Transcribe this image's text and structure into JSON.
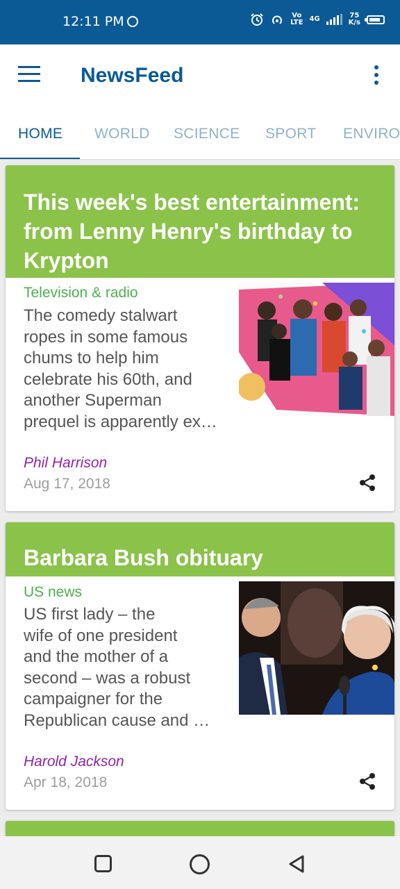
{
  "status": {
    "time": "12:11 PM",
    "lte_top": "Vo",
    "lte_bottom": "LTE",
    "net_badge": "4G",
    "speed_top": "75",
    "speed_bottom": "K/s",
    "icons": [
      "hotspot-icon",
      "alarm-icon",
      "wifi-hotspot-icon",
      "signal-icon",
      "battery-icon"
    ]
  },
  "app_bar": {
    "title": "NewsFeed",
    "menu_icon": "hamburger-menu-icon",
    "more_icon": "more-vert-icon"
  },
  "tabs": [
    {
      "label": "HOME",
      "active": true
    },
    {
      "label": "WORLD",
      "active": false
    },
    {
      "label": "SCIENCE",
      "active": false
    },
    {
      "label": "SPORT",
      "active": false
    },
    {
      "label": "ENVIRO",
      "active": false
    }
  ],
  "colors": {
    "primary": "#0b5a96",
    "header_green": "#8bc34a",
    "section_green": "#4caf50",
    "author_purple": "#8e24aa"
  },
  "articles": [
    {
      "title_lines": [
        "This week's best entertainment:",
        "from Lenny Henry's birthday to",
        "Krypton"
      ],
      "section": "Television & radio",
      "summary_lines": [
        "The comedy stalwart",
        "ropes in some famous",
        "chums to help him",
        "celebrate his 60th, and",
        "another Superman",
        "prequel is apparently ex…"
      ],
      "author": "Phil Harrison",
      "date": "Aug 17, 2018"
    },
    {
      "title_lines": [
        "Barbara Bush obituary"
      ],
      "section": "US news",
      "summary_lines": [
        "US first lady – the",
        "wife of one president",
        "and the mother of a",
        "second – was a robust",
        "campaigner for the",
        "Republican cause and …"
      ],
      "author": "Harold Jackson",
      "date": "Apr 18, 2018"
    }
  ],
  "nav": {
    "recents_icon": "recent-apps-icon",
    "home_icon": "home-circle-icon",
    "back_icon": "back-triangle-icon"
  }
}
